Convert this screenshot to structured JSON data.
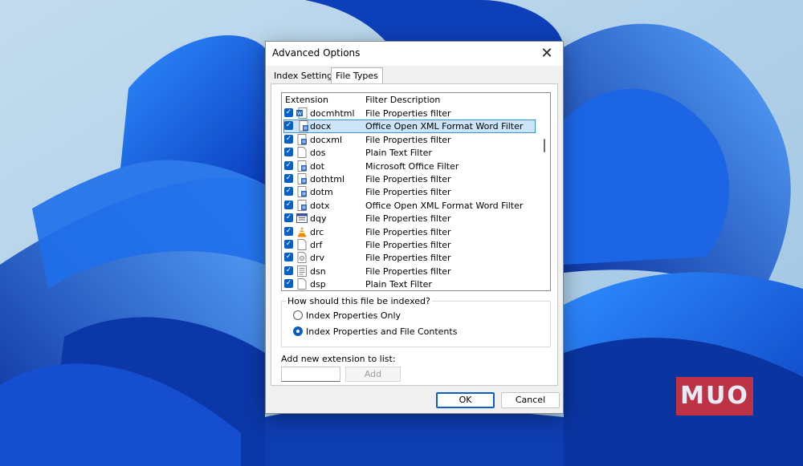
{
  "logo": {
    "text": "MUO"
  },
  "dialog": {
    "title": "Advanced Options",
    "close_glyph": "✕",
    "tabs": [
      {
        "label": "Index Settings",
        "active": false
      },
      {
        "label": "File Types",
        "active": true
      }
    ],
    "list": {
      "columns": {
        "extension": "Extension",
        "filter": "Filter Description"
      },
      "rows": [
        {
          "ext": "docmhtml",
          "filter": "File Properties filter",
          "checked": true,
          "icon": "word-icon",
          "selected": false
        },
        {
          "ext": "docx",
          "filter": "Office Open XML Format Word Filter",
          "checked": true,
          "icon": "word-doc-icon",
          "selected": true
        },
        {
          "ext": "docxml",
          "filter": "File Properties filter",
          "checked": true,
          "icon": "word-doc-icon",
          "selected": false
        },
        {
          "ext": "dos",
          "filter": "Plain Text Filter",
          "checked": true,
          "icon": "blank-file-icon",
          "selected": false
        },
        {
          "ext": "dot",
          "filter": "Microsoft Office Filter",
          "checked": true,
          "icon": "word-doc-icon",
          "selected": false
        },
        {
          "ext": "dothtml",
          "filter": "File Properties filter",
          "checked": true,
          "icon": "word-doc-icon",
          "selected": false
        },
        {
          "ext": "dotm",
          "filter": "File Properties filter",
          "checked": true,
          "icon": "word-doc-icon",
          "selected": false
        },
        {
          "ext": "dotx",
          "filter": "Office Open XML Format Word Filter",
          "checked": true,
          "icon": "word-doc-icon",
          "selected": false
        },
        {
          "ext": "dqy",
          "filter": "File Properties filter",
          "checked": true,
          "icon": "query-file-icon",
          "selected": false
        },
        {
          "ext": "drc",
          "filter": "File Properties filter",
          "checked": true,
          "icon": "vlc-cone-icon",
          "selected": false
        },
        {
          "ext": "drf",
          "filter": "File Properties filter",
          "checked": true,
          "icon": "blank-file-icon",
          "selected": false
        },
        {
          "ext": "drv",
          "filter": "File Properties filter",
          "checked": true,
          "icon": "driver-file-icon",
          "selected": false
        },
        {
          "ext": "dsn",
          "filter": "File Properties filter",
          "checked": true,
          "icon": "text-file-icon",
          "selected": false
        },
        {
          "ext": "dsp",
          "filter": "Plain Text Filter",
          "checked": true,
          "icon": "blank-file-icon",
          "selected": false
        }
      ]
    },
    "index_group": {
      "legend": "How should this file be indexed?",
      "options": [
        {
          "label": "Index Properties Only",
          "selected": false
        },
        {
          "label": "Index Properties and File Contents",
          "selected": true
        }
      ]
    },
    "add_extension": {
      "label": "Add new extension to list:",
      "value": "",
      "button": "Add"
    },
    "buttons": {
      "ok": "OK",
      "cancel": "Cancel"
    }
  },
  "colors": {
    "accent": "#0a5fc4",
    "selection": "#cce4f7",
    "logo": "#d2323c"
  }
}
